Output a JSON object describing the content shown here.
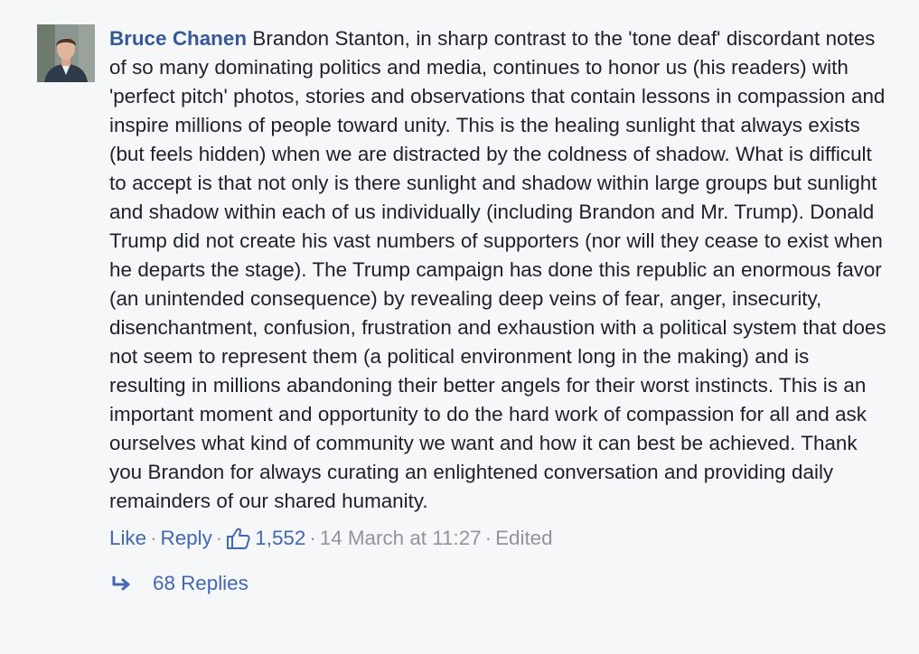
{
  "comment": {
    "author": "Bruce Chanen",
    "text": "Brandon Stanton, in sharp contrast to the 'tone deaf' discordant notes of so many dominating politics and media, continues to honor us (his readers) with 'perfect pitch' photos, stories and observations that contain lessons in compassion and inspire millions of people toward unity. This is the healing sunlight that always exists (but feels hidden) when we are distracted by the coldness of shadow. What is difficult to accept is that not only is there sunlight and shadow within large groups but sunlight and shadow within each of us individually (including Brandon and Mr. Trump). Donald Trump did not create his vast numbers of supporters (nor will they cease to exist when he departs the stage). The Trump campaign has done this republic an enormous favor (an unintended consequence) by revealing deep veins of fear, anger, insecurity, disenchantment, confusion, frustration and exhaustion with a political system that does not seem to represent them (a political environment long in the making) and is resulting in millions abandoning their better angels for their worst instincts. This is an important moment and opportunity to do the hard work of compassion for all and ask ourselves what kind of community we want and how it can best be achieved. Thank you Brandon for always curating an enlightened conversation and providing daily remainders of our shared humanity.",
    "actions": {
      "like_label": "Like",
      "reply_label": "Reply",
      "separator": "·",
      "like_count": "1,552",
      "timestamp": "14 March at 11:27",
      "edited_label": "Edited"
    },
    "replies_label": "68 Replies"
  },
  "icons": {
    "thumbs_up": "thumbs-up-icon",
    "reply_arrow": "reply-arrow-icon"
  },
  "colors": {
    "link": "#4267b2",
    "author": "#365899",
    "text": "#1d2129",
    "meta": "#90949c",
    "background": "#f6f7f9"
  }
}
